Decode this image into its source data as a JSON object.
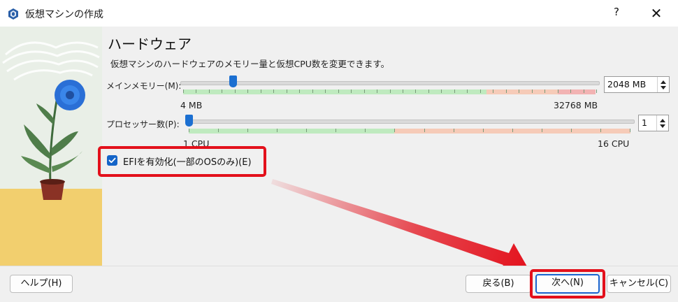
{
  "window": {
    "title": "仮想マシンの作成",
    "help_label": "?",
    "close_label": "✕"
  },
  "page": {
    "heading": "ハードウェア",
    "description": "仮想マシンのハードウェアのメモリー量と仮想CPU数を変更できます。"
  },
  "memory": {
    "label": "メインメモリー(M):",
    "value": "2048 MB",
    "min_label": "4 MB",
    "max_label": "32768 MB",
    "value_mb": 2048,
    "min_mb": 4,
    "max_mb": 32768
  },
  "processor": {
    "label": "プロセッサー数(P):",
    "value": "1",
    "min_label": "1 CPU",
    "max_label": "16 CPU",
    "value_cpu": 1,
    "min_cpu": 1,
    "max_cpu": 16
  },
  "efi": {
    "label": "EFIを有効化(一部のOSのみ)(E)",
    "checked": true
  },
  "buttons": {
    "help": "ヘルプ(H)",
    "back": "戻る(B)",
    "next": "次へ(N)",
    "cancel": "キャンセル(C)"
  },
  "colors": {
    "accent": "#1b6fd1",
    "annotation_red": "#e3101b",
    "safe_zone": "#bfeabf",
    "warn_zone": "#f6cbb8",
    "danger_zone": "#f2b3b3"
  },
  "icons": [
    "virtualbox-logo-icon",
    "help-icon",
    "close-icon",
    "checkmark-icon",
    "spin-up-icon",
    "spin-down-icon"
  ]
}
